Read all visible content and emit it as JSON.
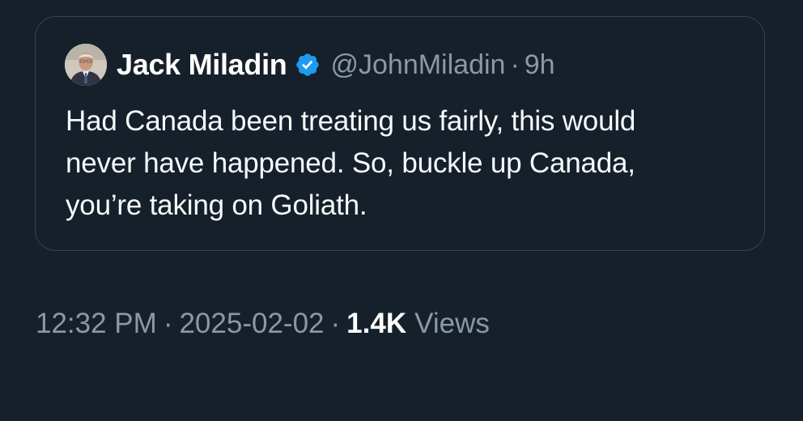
{
  "quoted_tweet": {
    "author_name": "Jack Miladin",
    "handle": "@JohnMiladin",
    "separator": "·",
    "time_ago": "9h",
    "verified": true,
    "verified_color": "#1d9bf0",
    "text_lines": [
      "Had Canada been treating us fairly, this would",
      "never have happened. So, buckle up Canada,",
      "you’re taking on Goliath."
    ]
  },
  "tweet_meta": {
    "time": "12:32 PM",
    "separator": "·",
    "date": "2025-02-02",
    "views_count": "1.4K",
    "views_label": "Views"
  },
  "icons": {
    "avatar": "profile-photo",
    "verified": "verified-badge-icon"
  },
  "colors": {
    "background": "#15202b",
    "border": "#38444d",
    "primary_text": "#f7f9f9",
    "secondary_text": "#8b98a5"
  }
}
